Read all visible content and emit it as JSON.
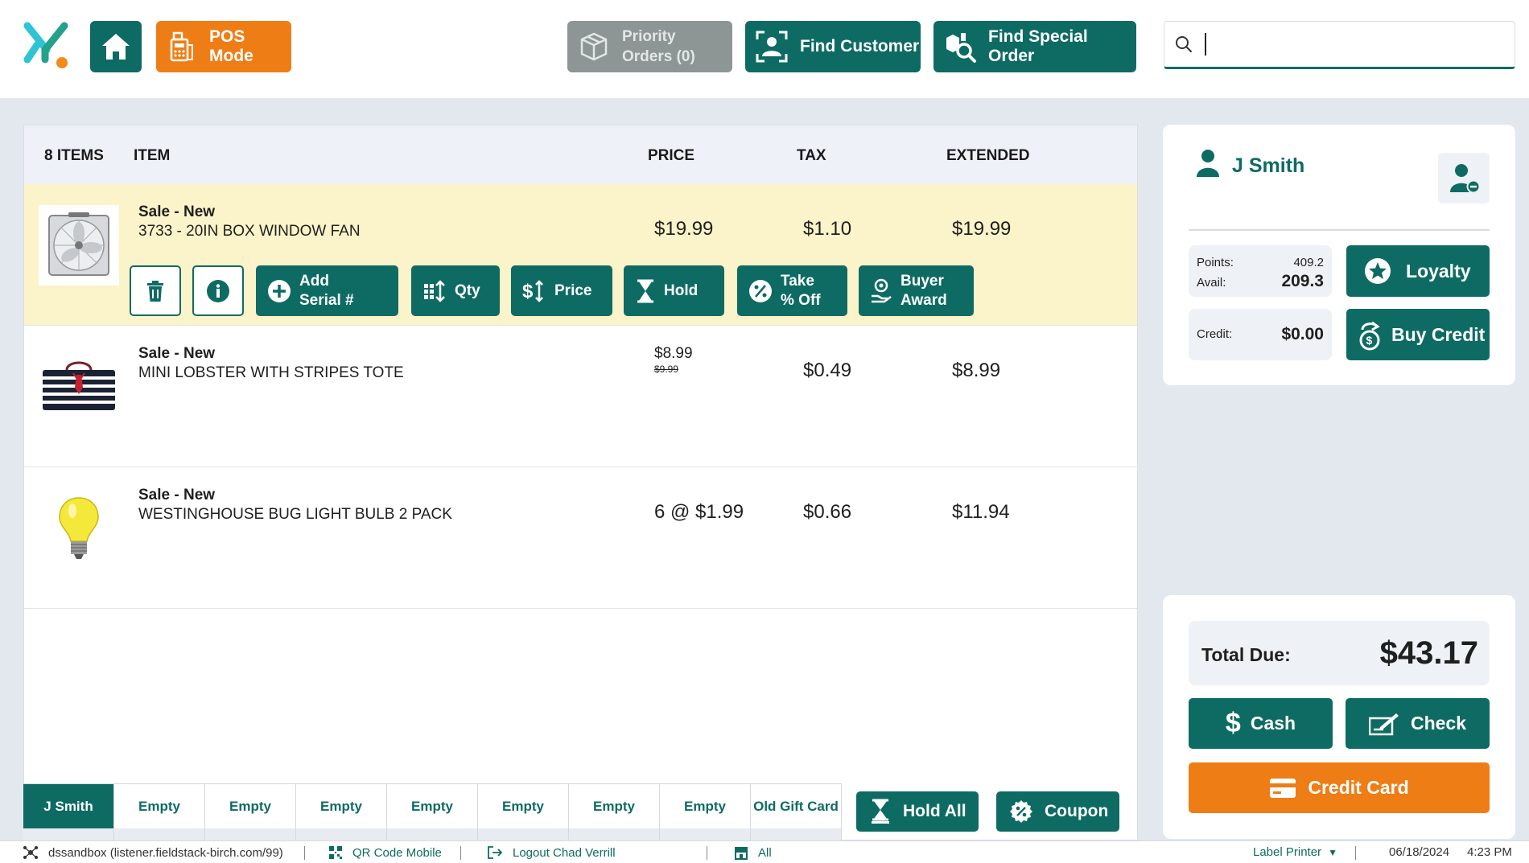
{
  "header": {
    "pos_mode_label": "POS Mode",
    "priority_orders_line1": "Priority",
    "priority_orders_line2": "Orders (0)",
    "find_customer_label": "Find Customer",
    "find_special_order_label": "Find Special Order",
    "search_value": ""
  },
  "cart": {
    "columns": {
      "count": "8 ITEMS",
      "item": "ITEM",
      "price": "PRICE",
      "tax": "TAX",
      "extended": "EXTENDED"
    },
    "items": [
      {
        "type": "Sale - New",
        "name": "3733 - 20IN BOX WINDOW FAN",
        "price": "$19.99",
        "tax": "$1.10",
        "extended": "$19.99"
      },
      {
        "type": "Sale - New",
        "name": "MINI LOBSTER WITH STRIPES TOTE",
        "price": "$8.99",
        "original_price": "$9.99",
        "tax": "$0.49",
        "extended": "$8.99"
      },
      {
        "type": "Sale - New",
        "name": "WESTINGHOUSE BUG LIGHT BULB 2 PACK",
        "price": "6 @ $1.99",
        "tax": "$0.66",
        "extended": "$11.94"
      }
    ],
    "actions": {
      "add_serial_1": "Add",
      "add_serial_2": "Serial #",
      "qty": "Qty",
      "price": "Price",
      "hold": "Hold",
      "take_off_1": "Take",
      "take_off_2": "% Off",
      "buyer_award_1": "Buyer",
      "buyer_award_2": "Award"
    }
  },
  "tabs": [
    "J Smith",
    "Empty",
    "Empty",
    "Empty",
    "Empty",
    "Empty",
    "Empty",
    "Empty",
    "Old Gift Card"
  ],
  "bottom_actions": {
    "hold_all": "Hold All",
    "coupon": "Coupon"
  },
  "customer": {
    "name": "J Smith",
    "points_label": "Points:",
    "points_value": "409.2",
    "avail_label": "Avail:",
    "avail_value": "209.3",
    "credit_label": "Credit:",
    "credit_value": "$0.00",
    "loyalty_label": "Loyalty",
    "buy_credit_label": "Buy Credit"
  },
  "payment": {
    "total_label": "Total Due:",
    "total_value": "$43.17",
    "cash_label": "Cash",
    "check_label": "Check",
    "credit_card_label": "Credit Card"
  },
  "status_bar": {
    "server": "dssandbox (listener.fieldstack-birch.com/99)",
    "qr_code": "QR Code Mobile",
    "logout": "Logout Chad  Verrill",
    "store": "All",
    "label_printer": "Label Printer",
    "date": "06/18/2024",
    "time": "4:23 PM"
  },
  "colors": {
    "brand_teal": "#0e6b63",
    "accent_orange": "#ef7d16",
    "disabled_gray": "#8e9595",
    "selected_row": "#fbf3c9"
  }
}
